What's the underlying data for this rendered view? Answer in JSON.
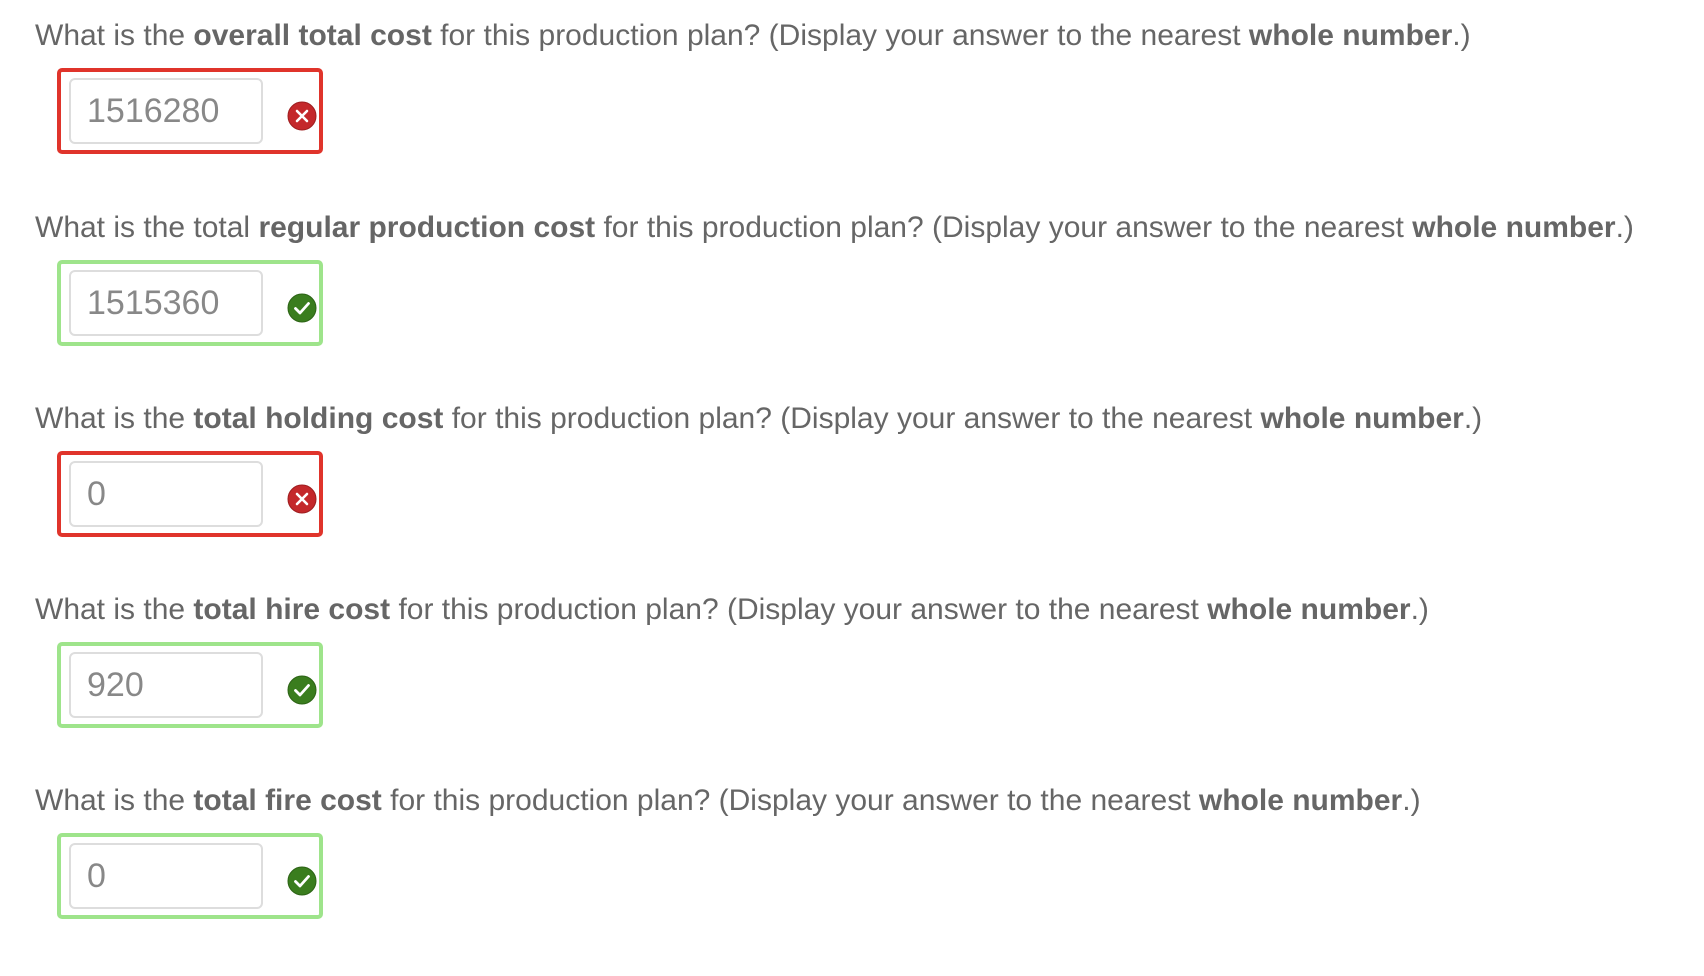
{
  "questions": [
    {
      "text_before": "What is the ",
      "text_bold": "overall total cost",
      "text_after": " for this production plan? (Display your answer to the nearest ",
      "text_bold2": "whole number",
      "text_end": ".)",
      "answer": "1516280",
      "status": "incorrect",
      "icon": "x-circle-icon"
    },
    {
      "text_before": "What is the total ",
      "text_bold": "regular production cost",
      "text_after": " for this production plan? (Display your answer to the nearest ",
      "text_bold2": "whole number",
      "text_end": ".)",
      "answer": "1515360",
      "status": "correct",
      "icon": "check-circle-icon"
    },
    {
      "text_before": "What is the ",
      "text_bold": "total holding cost",
      "text_after": " for this production plan? (Display your answer to the nearest ",
      "text_bold2": "whole number",
      "text_end": ".)",
      "answer": "0",
      "status": "incorrect",
      "icon": "x-circle-icon"
    },
    {
      "text_before": "What is the ",
      "text_bold": "total hire cost",
      "text_after": " for this production plan? (Display your answer to the nearest ",
      "text_bold2": "whole number",
      "text_end": ".)",
      "answer": "920",
      "status": "correct",
      "icon": "check-circle-icon"
    },
    {
      "text_before": "What is the ",
      "text_bold": "total fire cost",
      "text_after": " for this production plan? (Display your answer to the nearest ",
      "text_bold2": "whole number",
      "text_end": ".)",
      "answer": "0",
      "status": "correct",
      "icon": "check-circle-icon"
    }
  ],
  "colors": {
    "incorrect_border": "#e0342b",
    "correct_border": "#9ee48b",
    "incorrect_icon": "#c4282b",
    "correct_icon": "#3a7d1e",
    "text": "#666666",
    "input_text": "#888888"
  }
}
